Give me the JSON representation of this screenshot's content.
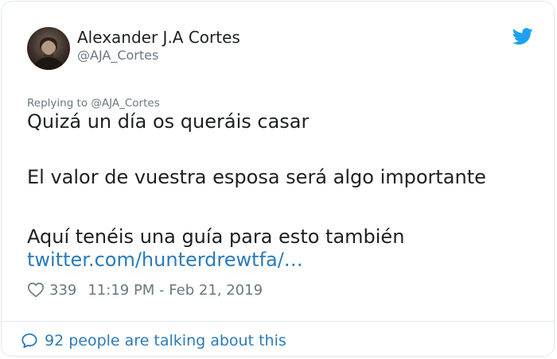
{
  "author": {
    "name": "Alexander J.A Cortes",
    "handle": "@AJA_Cortes"
  },
  "tweet": {
    "replying_to": "Replying to @AJA_Cortes",
    "line1": "Quizá un día os queráis casar",
    "line2": "El valor de vuestra esposa será algo importante",
    "line3": "Aquí tenéis una guía para esto también",
    "link": "twitter.com/hunterdrewtfa/…"
  },
  "meta": {
    "likes": "339",
    "timestamp": "11:19 PM - Feb 21, 2019"
  },
  "footer": {
    "talking": "92 people are talking about this"
  },
  "colors": {
    "brand": "#1da1f2",
    "link": "#2b7bb9",
    "muted": "#697882",
    "text": "#1c2022"
  },
  "icons": {
    "avatar": "avatar",
    "brand": "twitter-bird-icon",
    "like": "heart-icon",
    "comments": "speech-bubble-icon"
  }
}
